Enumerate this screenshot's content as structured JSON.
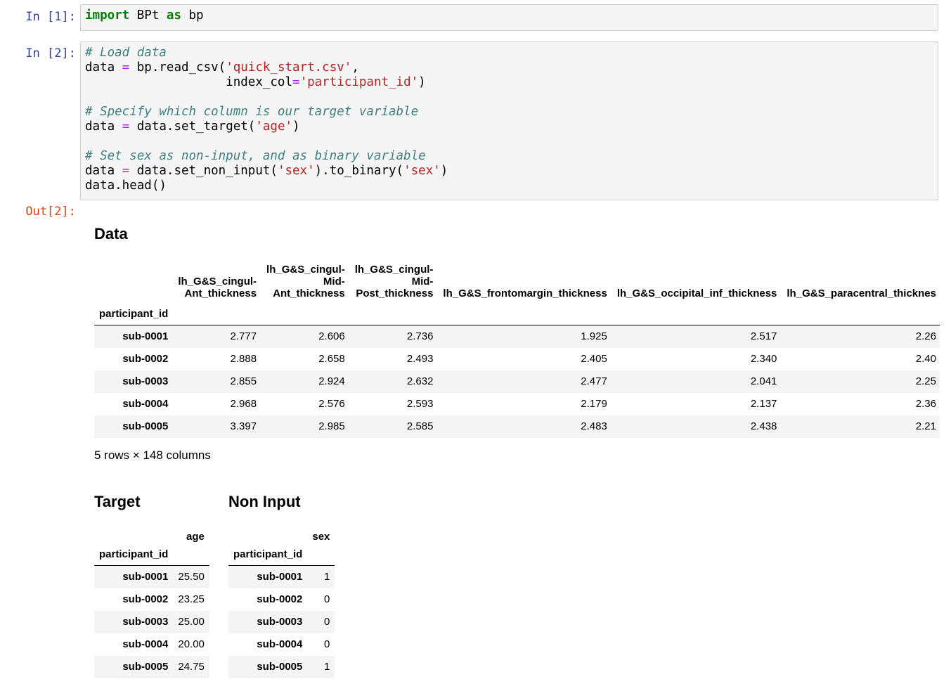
{
  "cells": [
    {
      "prompt": "In [1]:"
    },
    {
      "prompt": "In [2]:"
    }
  ],
  "output": {
    "prompt": "Out[2]:"
  },
  "data_section": {
    "title": "Data",
    "index_name": "participant_id",
    "columns": [
      "lh_G&S_cingul-Ant_thickness",
      "lh_G&S_cingul-Mid-Ant_thickness",
      "lh_G&S_cingul-Mid-Post_thickness",
      "lh_G&S_frontomargin_thickness",
      "lh_G&S_occipital_inf_thickness",
      "lh_G&S_paracentral_thicknes"
    ],
    "rows": [
      {
        "id": "sub-0001",
        "values": [
          "2.777",
          "2.606",
          "2.736",
          "1.925",
          "2.517",
          "2.26"
        ]
      },
      {
        "id": "sub-0002",
        "values": [
          "2.888",
          "2.658",
          "2.493",
          "2.405",
          "2.340",
          "2.40"
        ]
      },
      {
        "id": "sub-0003",
        "values": [
          "2.855",
          "2.924",
          "2.632",
          "2.477",
          "2.041",
          "2.25"
        ]
      },
      {
        "id": "sub-0004",
        "values": [
          "2.968",
          "2.576",
          "2.593",
          "2.179",
          "2.137",
          "2.36"
        ]
      },
      {
        "id": "sub-0005",
        "values": [
          "3.397",
          "2.985",
          "2.585",
          "2.483",
          "2.438",
          "2.21"
        ]
      }
    ],
    "shape_text": "5 rows × 148 columns"
  },
  "target_section": {
    "title": "Target",
    "index_name": "participant_id",
    "column": "age",
    "rows": [
      {
        "id": "sub-0001",
        "value": "25.50"
      },
      {
        "id": "sub-0002",
        "value": "23.25"
      },
      {
        "id": "sub-0003",
        "value": "25.00"
      },
      {
        "id": "sub-0004",
        "value": "20.00"
      },
      {
        "id": "sub-0005",
        "value": "24.75"
      }
    ]
  },
  "noninput_section": {
    "title": "Non Input",
    "index_name": "participant_id",
    "column": "sex",
    "rows": [
      {
        "id": "sub-0001",
        "value": "1"
      },
      {
        "id": "sub-0002",
        "value": "0"
      },
      {
        "id": "sub-0003",
        "value": "0"
      },
      {
        "id": "sub-0004",
        "value": "0"
      },
      {
        "id": "sub-0005",
        "value": "1"
      }
    ]
  }
}
